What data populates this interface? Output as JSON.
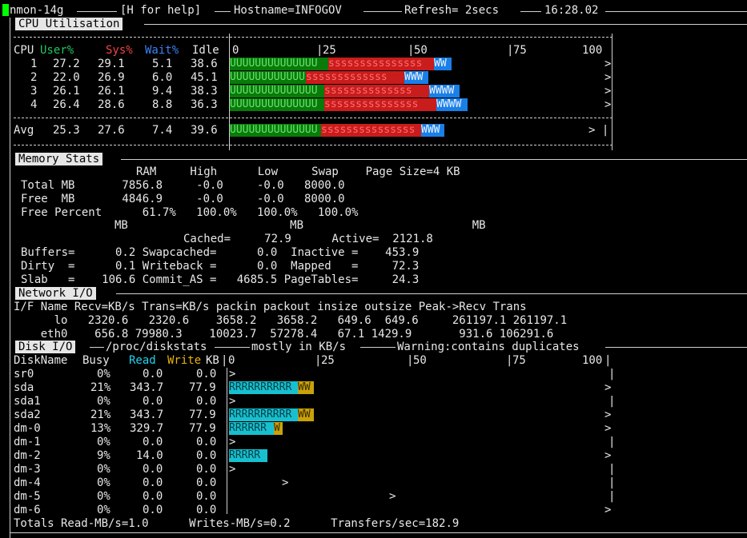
{
  "title_bar": {
    "app": "nmon-14g",
    "help": "[H for help]",
    "hostname": "Hostname=INFOGOV",
    "refresh": "Refresh= 2secs",
    "time": "16:28.02"
  },
  "cpu": {
    "section_title": "CPU Utilisation",
    "headers": {
      "cpu": "CPU",
      "user": "User%",
      "sys": "Sys%",
      "wait": "Wait%",
      "idle": "Idle"
    },
    "scale": [
      "0",
      "25",
      "50",
      "75",
      "100"
    ],
    "rows": [
      {
        "id": "1",
        "user": "27.2",
        "sys": "29.1",
        "wait": "5.1",
        "idle": "38.6",
        "bar_user": "UUUUUUUUUUUUUU",
        "bar_sys": "sssssssssssssss",
        "bar_wait": "WW",
        "end": ">"
      },
      {
        "id": "2",
        "user": "22.0",
        "sys": "26.9",
        "wait": "6.0",
        "idle": "45.1",
        "bar_user": "UUUUUUUUUUUU",
        "bar_sys": "sssssssssssss",
        "bar_wait": "WWW",
        "end": ">"
      },
      {
        "id": "3",
        "user": "26.1",
        "sys": "26.1",
        "wait": "9.4",
        "idle": "38.3",
        "bar_user": "UUUUUUUUUUUUUU",
        "bar_sys": "ssssssssssssss",
        "bar_wait": "WWWW",
        "end": ">"
      },
      {
        "id": "4",
        "user": "26.4",
        "sys": "28.6",
        "wait": "8.8",
        "idle": "36.3",
        "bar_user": "UUUUUUUUUUUUUU",
        "bar_sys": "sssssssssssssss",
        "bar_wait": "WWWW",
        "end": ">"
      }
    ],
    "avg": {
      "id": "Avg",
      "user": "25.3",
      "sys": "27.6",
      "wait": "7.4",
      "idle": "39.6",
      "bar_user": "UUUUUUUUUUUUUU",
      "bar_sys": "sssssssssssssss",
      "bar_wait": "WWW",
      "end": "> |"
    }
  },
  "memory": {
    "section_title": "Memory Stats",
    "header_line": "RAM     High      Low     Swap    Page Size=4 KB",
    "total": "Total MB       7856.8     -0.0     -0.0   8000.0",
    "free": "Free  MB       4846.9     -0.0     -0.0   8000.0",
    "free_pct": "Free Percent      61.7%   100.0%   100.0%   100.0%",
    "mb_line": "MB                        MB                         MB",
    "cached": "Cached=     72.9      Active=  2121.8",
    "buffers": "Buffers=      0.2 Swapcached=      0.0  Inactive =    453.9",
    "dirty": "Dirty  =      0.1 Writeback =      0.0  Mapped   =     72.3",
    "slab": "Slab   =    106.6 Commit_AS =   4685.5 PageTables=     24.3"
  },
  "network": {
    "section_title": "Network I/O",
    "header": "I/F Name Recv=KB/s Trans=KB/s packin packout insize outsize Peak->Recv Trans",
    "rows": [
      "      lo   2320.6   2320.6    3658.2   3658.2   649.6  649.6     261197.1 261197.1",
      "    eth0    656.8 79980.3    10023.7  57278.4   67.1 1429.9       931.6 106291.6"
    ]
  },
  "disk": {
    "section_title": "Disk I/O",
    "source": "/proc/diskstats",
    "units": "mostly in KB/s",
    "warning": "Warning:contains duplicates",
    "headers": {
      "name": "DiskName",
      "busy": "Busy",
      "read": "Read",
      "write": "Write",
      "kb": "KB"
    },
    "scale": [
      "0",
      "25",
      "50",
      "75",
      "100"
    ],
    "rows": [
      {
        "name": "sr0",
        "busy": "0%",
        "read": "0.0",
        "write": "0.0",
        "bar_r": "",
        "bar_w": "",
        "marker": ">",
        "end": "|"
      },
      {
        "name": "sda",
        "busy": "21%",
        "read": "343.7",
        "write": "77.9",
        "bar_r": "RRRRRRRRRR",
        "bar_w": "WW",
        "marker": "",
        "end": ">"
      },
      {
        "name": "sda1",
        "busy": "0%",
        "read": "0.0",
        "write": "0.0",
        "bar_r": "",
        "bar_w": "",
        "marker": ">",
        "end": "|"
      },
      {
        "name": "sda2",
        "busy": "21%",
        "read": "343.7",
        "write": "77.9",
        "bar_r": "RRRRRRRRRR",
        "bar_w": "WW",
        "marker": "",
        "end": ">"
      },
      {
        "name": "dm-0",
        "busy": "13%",
        "read": "329.7",
        "write": "77.9",
        "bar_r": "RRRRRR",
        "bar_w": "W",
        "marker": "",
        "end": ">"
      },
      {
        "name": "dm-1",
        "busy": "0%",
        "read": "0.0",
        "write": "0.0",
        "bar_r": "",
        "bar_w": "",
        "marker": ">",
        "end": "|"
      },
      {
        "name": "dm-2",
        "busy": "9%",
        "read": "14.0",
        "write": "0.0",
        "bar_r": "RRRRR",
        "bar_w": "",
        "marker": "",
        "end": ">"
      },
      {
        "name": "dm-3",
        "busy": "0%",
        "read": "0.0",
        "write": "0.0",
        "bar_r": "",
        "bar_w": "",
        "marker": ">",
        "end": "|"
      },
      {
        "name": "dm-4",
        "busy": "0%",
        "read": "0.0",
        "write": "0.0",
        "bar_r": "",
        "bar_w": "",
        "marker": ">",
        "end": "|"
      },
      {
        "name": "dm-5",
        "busy": "0%",
        "read": "0.0",
        "write": "0.0",
        "bar_r": "",
        "bar_w": "",
        "marker": ">",
        "end": "|"
      },
      {
        "name": "dm-6",
        "busy": "0%",
        "read": "0.0",
        "write": "0.0",
        "bar_r": "",
        "bar_w": "",
        "marker": "",
        "end": ">"
      }
    ],
    "totals": "Totals Read-MB/s=1.0      Writes-MB/s=0.2      Transfers/sec=182.9"
  }
}
